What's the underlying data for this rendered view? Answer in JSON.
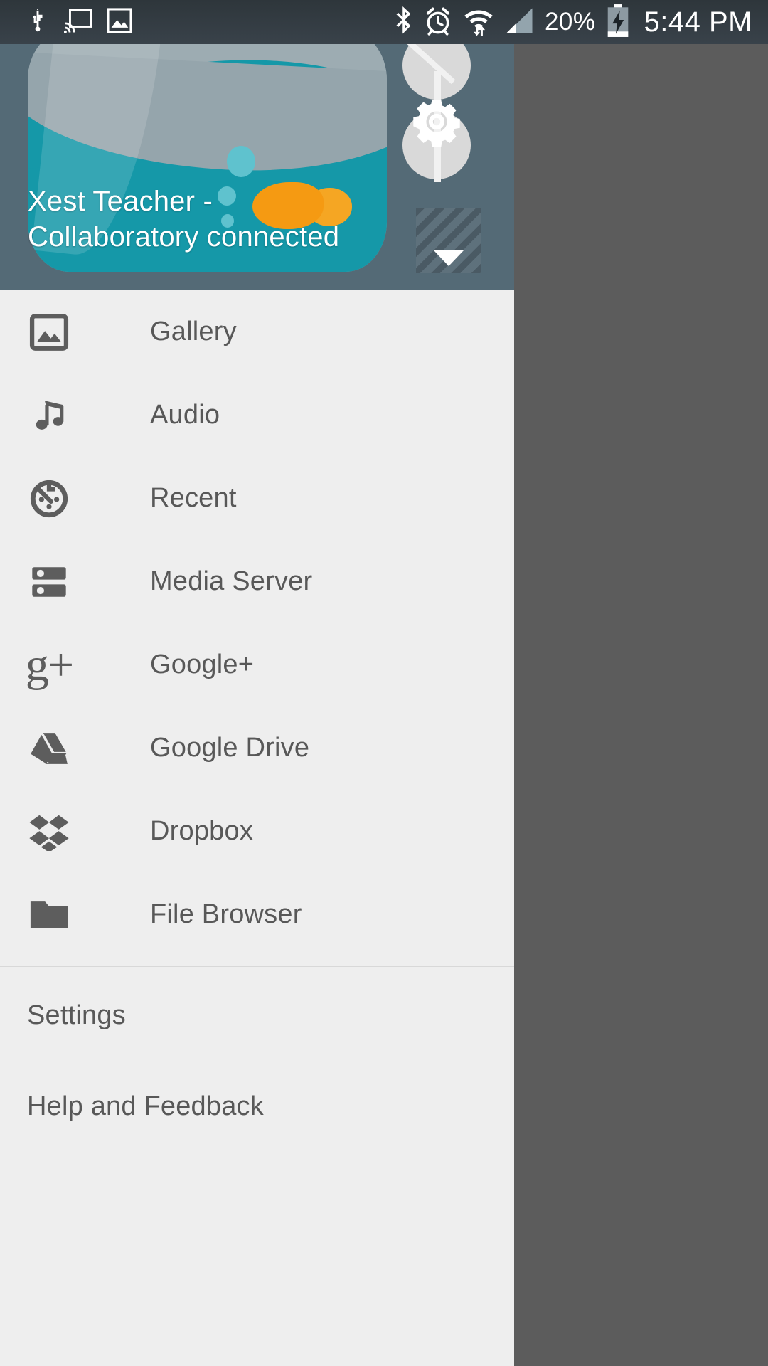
{
  "statusbar": {
    "battery_percent": "20%",
    "time": "5:44 PM",
    "icons": [
      "usb-icon",
      "cast-screen-icon",
      "screenshot-image-icon",
      "bluetooth-icon",
      "alarm-icon",
      "wifi-data-transfer-icon",
      "cellular-signal-icon",
      "battery-charging-icon"
    ]
  },
  "drawer": {
    "header": {
      "account_title": "Xest Teacher - Collaboratory",
      "account_status": "connected",
      "caption": "Xest Teacher - Collaboratory connected",
      "settings_icon": "gear-icon",
      "account_switcher_icon": "chevron-down-icon",
      "artwork": "fishbowl-illustration"
    },
    "items": [
      {
        "label": "Gallery",
        "icon": "gallery-image-icon"
      },
      {
        "label": "Audio",
        "icon": "music-note-icon"
      },
      {
        "label": "Recent",
        "icon": "history-clock-icon"
      },
      {
        "label": "Media Server",
        "icon": "media-server-icon"
      },
      {
        "label": "Google+",
        "icon": "google-plus-icon"
      },
      {
        "label": "Google Drive",
        "icon": "google-drive-icon"
      },
      {
        "label": "Dropbox",
        "icon": "dropbox-icon"
      },
      {
        "label": "File Browser",
        "icon": "folder-icon"
      }
    ],
    "footer_items": [
      {
        "label": "Settings"
      },
      {
        "label": "Help and Feedback"
      }
    ]
  },
  "colors": {
    "water_teal": "#1598a8",
    "bowl_glass": "#95a5ac",
    "fish_orange": "#f59a12",
    "header_bg": "#546a76",
    "drawer_bg": "#eeeeee",
    "scrim": "#5c5c5c",
    "text_primary": "#585858",
    "statusbar_bg": "#39424a"
  }
}
